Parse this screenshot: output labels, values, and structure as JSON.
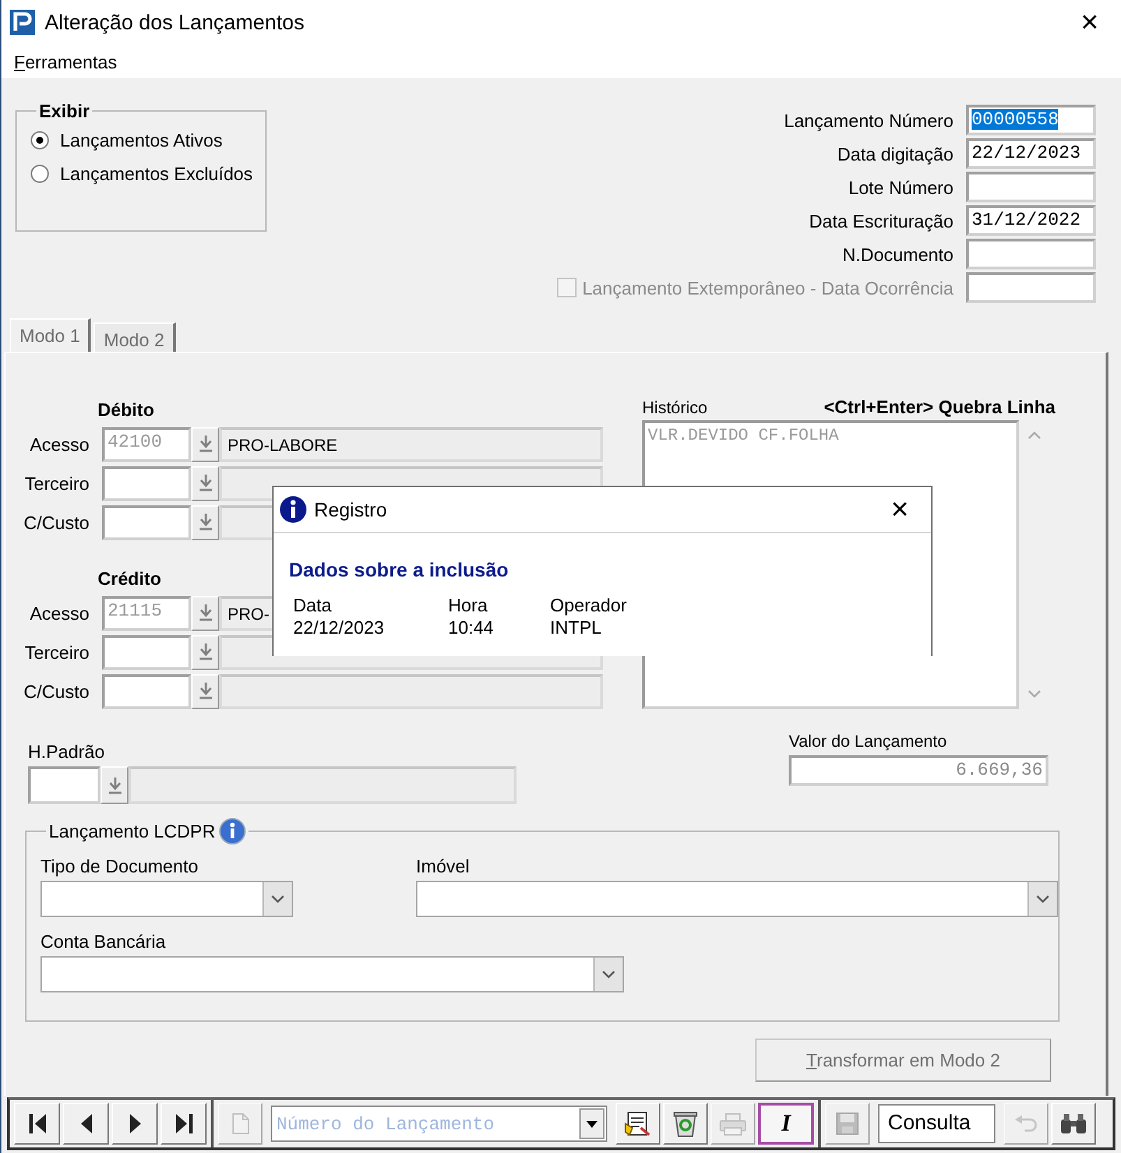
{
  "window": {
    "title": "Alteração dos Lançamentos",
    "close": "×"
  },
  "menu": [
    {
      "label": "Ferramentas"
    }
  ],
  "exibir": {
    "title": "Exibir",
    "options": [
      {
        "label": "Lançamentos Ativos",
        "selected": true
      },
      {
        "label": "Lançamentos Excluídos",
        "selected": false
      }
    ]
  },
  "header_fields": [
    {
      "kind": "field",
      "label": "Lançamento Número",
      "value": "00000558",
      "highlighted": true
    },
    {
      "kind": "field",
      "label": "Data digitação",
      "value": "22/12/2023",
      "highlighted": false
    },
    {
      "kind": "field",
      "label": "Lote Número"
    },
    {
      "kind": "field",
      "label": "Data Escrituração",
      "value": "31/12/2022",
      "highlighted": false
    },
    {
      "kind": "field",
      "label": "N.Documento"
    },
    {
      "kind": "checkbox",
      "label": "Lançamento Extemporâneo - Data Ocorrência",
      "checked": false,
      "disabled": true
    }
  ],
  "tabs": [
    {
      "label": "Modo 1",
      "selected": true
    },
    {
      "label": "Modo 2",
      "selected": false
    }
  ],
  "accounts": [
    {
      "title": "Débito",
      "rows": [
        {
          "label": "Acesso",
          "code": "42100",
          "description": "PRO-LABORE"
        },
        {
          "label": "Terceiro",
          "code": "",
          "description": ""
        },
        {
          "label": "C/Custo",
          "code": "",
          "description": ""
        }
      ]
    },
    {
      "title": "Crédito",
      "rows": [
        {
          "label": "Acesso",
          "code": "21115",
          "description": "PRO-"
        },
        {
          "label": "Terceiro",
          "code": "",
          "description": ""
        },
        {
          "label": "C/Custo",
          "code": "",
          "description": ""
        }
      ]
    }
  ],
  "h_padrao": {
    "label": "H.Padrão"
  },
  "historico": {
    "label": "Histórico",
    "hint": "<Ctrl+Enter> Quebra Linha",
    "value": "VLR.DEVIDO CF.FOLHA"
  },
  "valor": {
    "label": "Valor do Lançamento",
    "value": "6.669,36"
  },
  "lcdpr": {
    "title": "Lançamento LCDPR",
    "fields": [
      {
        "label": "Tipo de Documento"
      },
      {
        "label": "Imóvel"
      },
      {
        "label": "Conta Bancária"
      }
    ]
  },
  "transform_button": {
    "label": "Transformar em Modo 2"
  },
  "toolbar": {
    "nav": [
      {
        "kind": "first",
        "disabled": false
      },
      {
        "kind": "prev",
        "disabled": false
      },
      {
        "kind": "next",
        "disabled": false
      },
      {
        "kind": "last",
        "disabled": false
      }
    ],
    "actions": [
      {
        "kind": "new",
        "disabled": true,
        "selected": false
      },
      {
        "kind": "combo",
        "placeholder": "Número do Lançamento"
      },
      {
        "kind": "report",
        "disabled": false,
        "selected": false
      },
      {
        "kind": "recycle",
        "disabled": false,
        "selected": false
      },
      {
        "kind": "print",
        "disabled": true,
        "selected": false
      },
      {
        "kind": "text",
        "label": "I",
        "disabled": false,
        "selected": true
      }
    ],
    "tail": [
      {
        "kind": "save",
        "disabled": true
      },
      {
        "kind": "mode",
        "value": "Consulta"
      },
      {
        "kind": "undo",
        "disabled": true
      },
      {
        "kind": "find",
        "disabled": false
      }
    ]
  },
  "dialog": {
    "title": "Registro",
    "close": "×",
    "heading": "Dados sobre a inclusão",
    "columns": [
      {
        "label": "Data",
        "value": "22/12/2023"
      },
      {
        "label": "Hora",
        "value": "10:44"
      },
      {
        "label": "Operador",
        "value": "INTPL"
      }
    ]
  }
}
